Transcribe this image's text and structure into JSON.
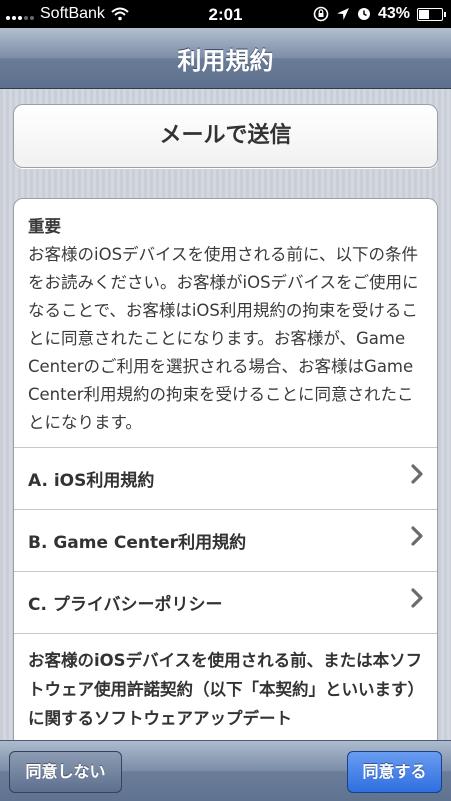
{
  "status_bar": {
    "carrier": "SoftBank",
    "time": "2:01",
    "battery_percent": "43%",
    "battery_level": 0.43,
    "icons": [
      "signal-icon",
      "wifi-icon",
      "rotation-lock-icon",
      "location-icon",
      "alarm-icon",
      "battery-icon"
    ]
  },
  "navbar": {
    "title": "利用規約"
  },
  "email_button": {
    "label": "メールで送信"
  },
  "terms": {
    "heading": "重要",
    "intro": "お客様のiOSデバイスを使用される前に、以下の条件をお読みください。お客様がiOSデバイスをご使用になることで、お客様はiOS利用規約の拘束を受けることに同意されたことになります。お客様が、Game Centerのご利用を選択される場合、お客様はGame Center利用規約の拘束を受けることに同意されたことになります。",
    "items": [
      {
        "label": "A. iOS利用規約"
      },
      {
        "label": "B. Game Center利用規約"
      },
      {
        "label": "C. プライバシーポリシー"
      }
    ],
    "body": "お客様のiOSデバイスを使用される前、または本ソフトウェア使用許諾契約（以下「本契約」といいます）に関するソフトウェアアップデート"
  },
  "toolbar": {
    "disagree_label": "同意しない",
    "agree_label": "同意する"
  },
  "colors": {
    "navbar": "#6a7c97",
    "agree_button": "#2f6fe0",
    "disagree_button": "#6e7f99",
    "background": "#cfd4dc"
  }
}
